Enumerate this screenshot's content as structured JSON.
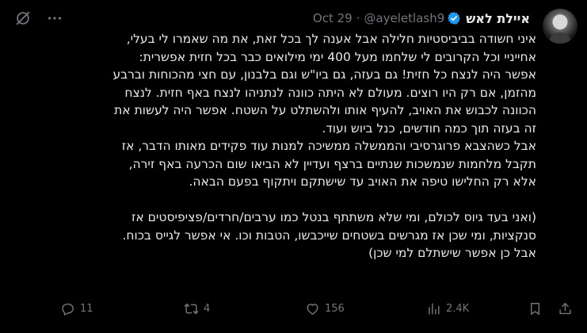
{
  "tweet": {
    "author": {
      "display_name": "איילת לאש",
      "handle": "@ayeletlash9",
      "verified": true
    },
    "separator": "·",
    "date": "Oct 29",
    "lines": [
      "איני חשודה בביביסטיות חלילה אבל אענה לך בכל זאת, את מה שאמרו לי בעלי,",
      "אחייניי וכל הקרובים לי שלחמו מעל 400 ימי מילואים כבר בכל חזית אפשרית:",
      "אפשר היה לנצח כל חזית! גם בעזה, גם ביו\"ש וגם בלבנון, עם חצי מהכוחות וברבע",
      "מהזמן, אם רק היו רוצים. מעולם לא היתה כוונה לנתניהו לנצח באף חזית. לנצח",
      "הכוונה לכבוש את האויב, להעיף אותו ולהשתלט על השטח. אפשר היה לעשות את",
      "זה בעזה תוך כמה חודשים, כנל ביוש ועוד.",
      "אבל כשהצבא פרוגרסיבי והממשלה ממשיכה למנות עוד פקידים מאותו הדבר, אז",
      "תקבל מלחמות שנמשכות שנתיים ברצף ועדיין לא הביאו שום הכרעה באף זירה,",
      "אלא רק החלישו טיפה את האויב עד שישתקם ויתקוף בפעם הבאה.",
      "",
      "(ואני בעד גיוס לכולם, ומי שלא משתתף בנטל כמו ערבים/חרדים/פציפיסטים אז",
      "סנקציות, ומי שכן אז מגרשים בשטחים שייכבשו, הטבות וכו. אי אפשר לגייס בכוח.",
      "אבל כן אפשר שישתלם למי שכן)"
    ],
    "stats": {
      "replies": "11",
      "reposts": "4",
      "likes": "156",
      "views": "2.4K"
    },
    "icons": {
      "reply": "reply-icon",
      "repost": "repost-icon",
      "like": "heart-icon",
      "views": "views-icon",
      "bookmark": "bookmark-icon",
      "share": "share-icon",
      "grok": "grok-icon",
      "more": "more-icon",
      "verified": "verified-badge-icon"
    },
    "colors": {
      "background": "#000000",
      "text": "#e7e9ea",
      "muted": "#71767b",
      "verified": "#1d9bf0"
    }
  }
}
